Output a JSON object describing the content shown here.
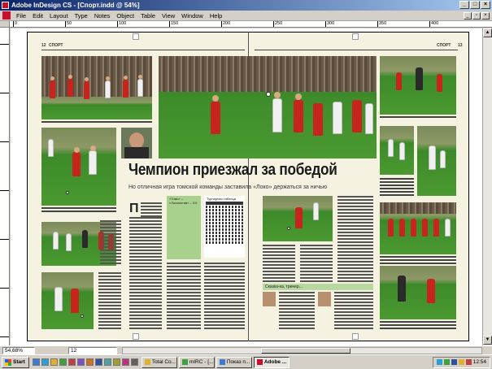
{
  "window": {
    "title": "Adobe InDesign CS - [Спорт.indd @ 54%]",
    "controls": {
      "minimize": "_",
      "maximize": "□",
      "close": "×"
    }
  },
  "menu": {
    "items": [
      "File",
      "Edit",
      "Layout",
      "Type",
      "Notes",
      "Object",
      "Table",
      "View",
      "Window",
      "Help"
    ]
  },
  "ruler": {
    "ticks": [
      "0",
      "50",
      "100",
      "150",
      "200",
      "250",
      "300",
      "350",
      "400"
    ]
  },
  "spread": {
    "left_folio_number": "12",
    "left_folio_section": "СПОРТ",
    "right_folio_section": "СПОРТ",
    "right_folio_number": "13",
    "headline": "Чемпион приезжал за победой",
    "subhead": "Но отличная игра томской команды заставила «Локо» держаться за ничью",
    "dropcap": "П",
    "green_box_title": "«Томь» – «Локомотив» – 0:0",
    "score_table_title": "Турнирная таблица",
    "sidebar_banner": "Сказка-ка, тренер..."
  },
  "status": {
    "zoom": "54,68%",
    "page": "12"
  },
  "taskbar": {
    "start_label": "Start",
    "tasks": [
      {
        "label": "Total Co...",
        "active": false
      },
      {
        "label": "mIRC - [...",
        "active": false
      },
      {
        "label": "Показ п...",
        "active": false
      },
      {
        "label": "Adobe ...",
        "active": true
      }
    ],
    "clock": "12:54"
  },
  "colors": {
    "titlebar_start": "#0a246a",
    "page_paper": "#f6f2e2",
    "lokomotiv_red": "#c8241e",
    "sidebar_green": "#a9d18e"
  }
}
